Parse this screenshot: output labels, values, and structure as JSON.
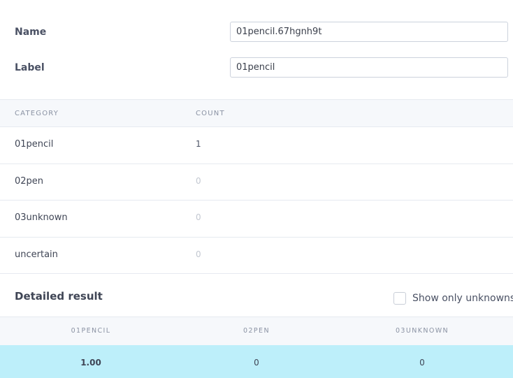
{
  "form": {
    "name_label": "Name",
    "name_value": "01pencil.67hgnh9t",
    "label_label": "Label",
    "label_value": "01pencil"
  },
  "category_table": {
    "headers": [
      "CATEGORY",
      "COUNT"
    ],
    "rows": [
      {
        "category": "01pencil",
        "count": "1"
      },
      {
        "category": "02pen",
        "count": "0"
      },
      {
        "category": "03unknown",
        "count": "0"
      },
      {
        "category": "uncertain",
        "count": "0"
      }
    ]
  },
  "detailed": {
    "title": "Detailed result",
    "show_only_unknowns_label": "Show only unknowns",
    "show_only_unknowns_checked": false,
    "headers": [
      "01PENCIL",
      "02PEN",
      "03UNKNOWN"
    ],
    "row": [
      "1.00",
      "0",
      "0"
    ],
    "highlight_color": "#bdeffa"
  }
}
